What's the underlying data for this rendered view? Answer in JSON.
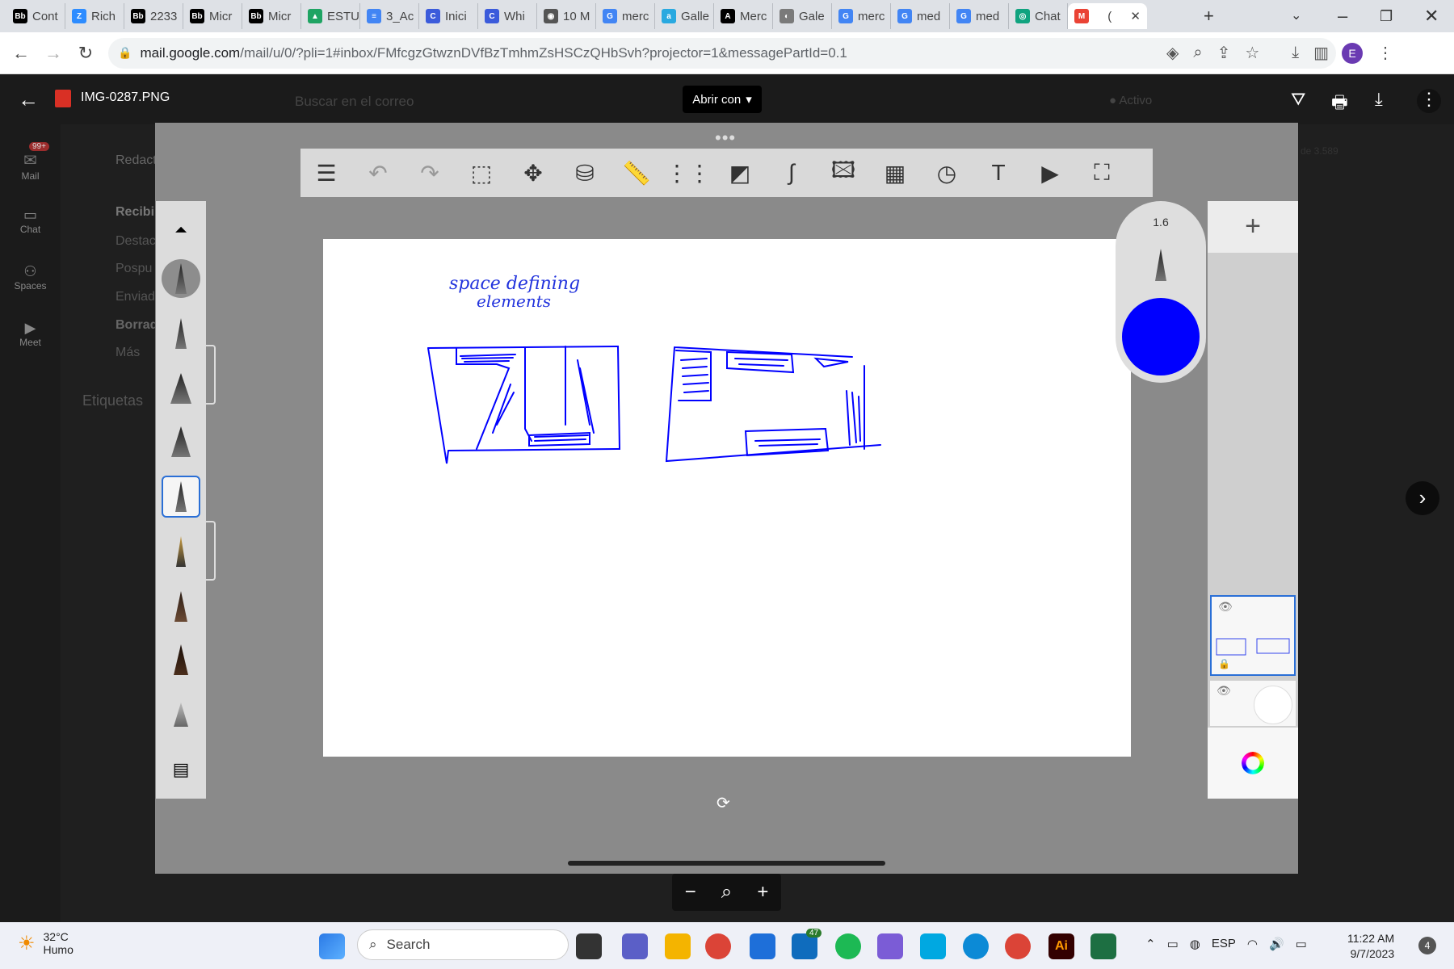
{
  "browser": {
    "tabs": [
      {
        "label": "Cont",
        "fav": "Bb",
        "color": "#000000"
      },
      {
        "label": "Rich",
        "fav": "Z",
        "color": "#2d8cff"
      },
      {
        "label": "2233",
        "fav": "Bb",
        "color": "#000000"
      },
      {
        "label": "Micr",
        "fav": "Bb",
        "color": "#000000"
      },
      {
        "label": "Micr",
        "fav": "Bb",
        "color": "#000000"
      },
      {
        "label": "ESTU",
        "fav": "▲",
        "color": "#1fa463"
      },
      {
        "label": "3_Ac",
        "fav": "≡",
        "color": "#4285f4"
      },
      {
        "label": "Inici",
        "fav": "C",
        "color": "#3b5bdb"
      },
      {
        "label": "Whi",
        "fav": "C",
        "color": "#3b5bdb"
      },
      {
        "label": "10 M",
        "fav": "◉",
        "color": "#555555"
      },
      {
        "label": "merc",
        "fav": "G",
        "color": "#4285f4"
      },
      {
        "label": "Galle",
        "fav": "a",
        "color": "#29a9e0"
      },
      {
        "label": "Merc",
        "fav": "A",
        "color": "#000000"
      },
      {
        "label": "Gale",
        "fav": "◐",
        "color": "#7a7a7a"
      },
      {
        "label": "merc",
        "fav": "G",
        "color": "#4285f4"
      },
      {
        "label": "med",
        "fav": "G",
        "color": "#4285f4"
      },
      {
        "label": "med",
        "fav": "G",
        "color": "#4285f4"
      },
      {
        "label": "Chat",
        "fav": "◎",
        "color": "#10a37f"
      }
    ],
    "active_tab": {
      "label": "(",
      "fav": "M",
      "color": "#ea4335"
    },
    "url_host": "mail.google.com",
    "url_rest": "/mail/u/0/?pli=1#inbox/FMfcgzGtwznDVfBzTmhmZsHSCzQHbSvh?projector=1&messagePartId=0.1",
    "profile_initial": "E"
  },
  "viewer": {
    "filename": "IMG-0287.PNG",
    "open_with": "Abrir con"
  },
  "gmail": {
    "rail": [
      {
        "label": "Mail",
        "badge": "99+"
      },
      {
        "label": "Chat"
      },
      {
        "label": "Spaces"
      },
      {
        "label": "Meet"
      }
    ],
    "compose": "Redact",
    "folders": [
      "Recibi",
      "Destac",
      "Pospu",
      "Enviad",
      "Borrad",
      "Más"
    ],
    "labels_title": "Etiquetas",
    "search_placeholder": "Buscar en el correo",
    "status": "Activo",
    "count_text": "de 3.589"
  },
  "app": {
    "brush_size": "1.6",
    "brush_color": "#0000ff",
    "sketch_text_line1": "space defining",
    "sketch_text_line2": "elements"
  },
  "taskbar": {
    "temp": "32°C",
    "weather": "Humo",
    "search_placeholder": "Search",
    "mail_badge": "47",
    "lang": "ESP",
    "time": "11:22 AM",
    "date": "9/7/2023",
    "notifications": "4"
  }
}
